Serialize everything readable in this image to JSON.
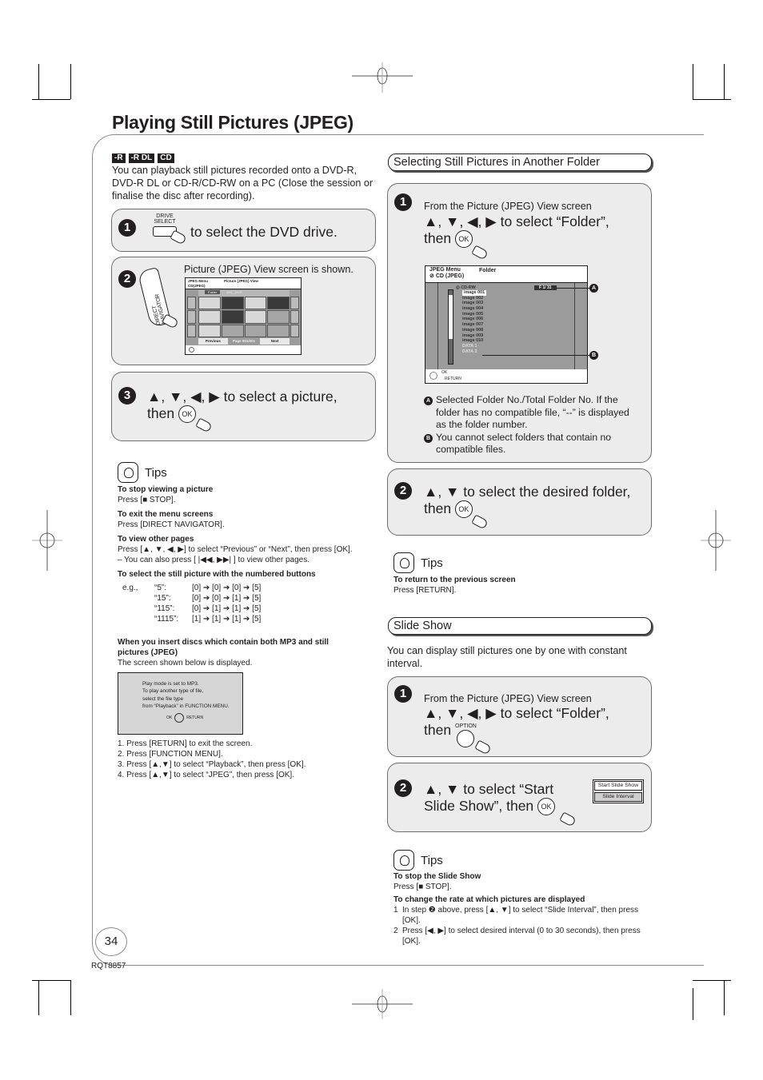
{
  "page": {
    "title": "Playing Still Pictures (JPEG)",
    "page_number": "34",
    "doc_code": "RQT8857"
  },
  "left": {
    "badges": [
      "-R",
      "-R DL",
      "CD"
    ],
    "intro": "You can playback still pictures recorded onto a DVD-R, DVD-R DL or CD-R/CD-RW on a PC (Close the session or finalise the disc after recording).",
    "step1": {
      "num": "1",
      "button_label_top": "DRIVE",
      "button_label_bottom": "SELECT",
      "text": "to select the DVD drive."
    },
    "step2": {
      "num": "2",
      "button_label": "DIRECT NAVIGATOR",
      "text": "Picture (JPEG) View screen is shown.",
      "screen": {
        "menu": "JPEG Menu",
        "view": "Picture (JPEG) View",
        "disc": "CD(JPEG)",
        "folder_tab": "Folder",
        "folder_name": "100__DVD",
        "previous": "Previous",
        "page": "Page 001/001",
        "next": "Next",
        "thumb_count": 12
      }
    },
    "step3": {
      "num": "3",
      "arrows": "▲, ▼, ◀, ▶",
      "text": "to select a picture,",
      "then": "then",
      "ok": "OK"
    },
    "tips": {
      "title": "Tips",
      "items": [
        {
          "heading": "To stop viewing a picture",
          "body": "Press [■ STOP]."
        },
        {
          "heading": "To exit the menu screens",
          "body": "Press [DIRECT NAVIGATOR]."
        },
        {
          "heading": "To view other pages",
          "body": "Press [▲, ▼, ◀, ▶] to select “Previous” or “Next”, then press [OK].",
          "body2": "– You can also press [ |◀◀, ▶▶| ] to view other pages."
        },
        {
          "heading": "To select the still picture with the numbered buttons",
          "body": ""
        }
      ],
      "sequence_prefix": "e.g.,",
      "sequences": [
        {
          "label": "“5”:",
          "keys": "[0] ➔ [0] ➔ [0] ➔ [5]"
        },
        {
          "label": "“15”:",
          "keys": "[0] ➔ [0] ➔ [1] ➔ [5]"
        },
        {
          "label": "“115”:",
          "keys": "[0] ➔ [1] ➔ [1] ➔ [5]"
        },
        {
          "label": "“1115”:",
          "keys": "[1] ➔ [1] ➔ [1] ➔ [5]"
        }
      ],
      "mp3_heading": "When you insert discs which contain both MP3 and still pictures (JPEG)",
      "mp3_body": "The screen shown below is displayed.",
      "mp3_screen": {
        "lines": [
          "Play mode is set to MP3.",
          "To play another type of file,",
          "select the file type",
          "from “Playback” in FUNCTION MENU."
        ],
        "ok": "OK",
        "return": "RETURN"
      },
      "mp3_steps": [
        "1. Press [RETURN] to exit the screen.",
        "2. Press [FUNCTION MENU].",
        "3. Press [▲,▼] to select “Playback”, then press [OK].",
        "4. Press [▲,▼] to select “JPEG”, then press [OK]."
      ]
    }
  },
  "right": {
    "folder_section": {
      "title": "Selecting Still Pictures in Another Folder",
      "step1": {
        "num": "1",
        "sub": "From the Picture (JPEG) View screen",
        "arrows": "▲, ▼, ◀, ▶",
        "text": "to select “Folder”,",
        "then": "then",
        "ok": "OK",
        "screen": {
          "menu": "JPEG Menu",
          "view": "Folder",
          "disc": "CD (JPEG)",
          "root": "CD-RW",
          "folders": [
            "image 001",
            "image 002",
            "image 003",
            "image 004",
            "image 005",
            "image 006",
            "image 007",
            "image 008",
            "image 009",
            "image 010",
            "DATA 1",
            "DATA 2"
          ],
          "folder_indicator": "F  1/ 31",
          "ok": "OK",
          "return": "RETURN",
          "callout_a": "A",
          "callout_b": "B"
        },
        "notes": [
          {
            "marker": "A",
            "text": "Selected Folder No./Total Folder No. If the folder has no compatible file, “--” is displayed as the folder number."
          },
          {
            "marker": "B",
            "text": "You cannot select folders that contain no compatible files."
          }
        ]
      },
      "step2": {
        "num": "2",
        "arrows": "▲, ▼",
        "text": "to select the desired folder,",
        "then": "then",
        "ok": "OK"
      },
      "tips": {
        "title": "Tips",
        "heading": "To return to the previous screen",
        "body": "Press [RETURN]."
      }
    },
    "slide_section": {
      "title": "Slide Show",
      "intro": "You can display still pictures one by one with constant interval.",
      "step1": {
        "num": "1",
        "sub": "From the Picture (JPEG) View screen",
        "arrows": "▲, ▼, ◀, ▶",
        "text": "to select “Folder”,",
        "then": "then",
        "button_label": "OPTION"
      },
      "step2": {
        "num": "2",
        "arrows": "▲, ▼",
        "text_line1": "to select “Start",
        "text_line2": "Slide Show”, then",
        "ok": "OK",
        "menu": [
          "Start Slide Show",
          "Slide Interval"
        ]
      },
      "tips": {
        "title": "Tips",
        "h1": "To stop the Slide Show",
        "b1": "Press [■ STOP].",
        "h2": "To change the rate at which pictures are displayed",
        "steps": [
          {
            "n": "1",
            "text": "In step ❷ above, press [▲, ▼] to select “Slide Interval”, then press [OK]."
          },
          {
            "n": "2",
            "text": "Press [◀, ▶] to select desired interval (0 to 30 seconds), then press [OK]."
          }
        ]
      }
    }
  }
}
